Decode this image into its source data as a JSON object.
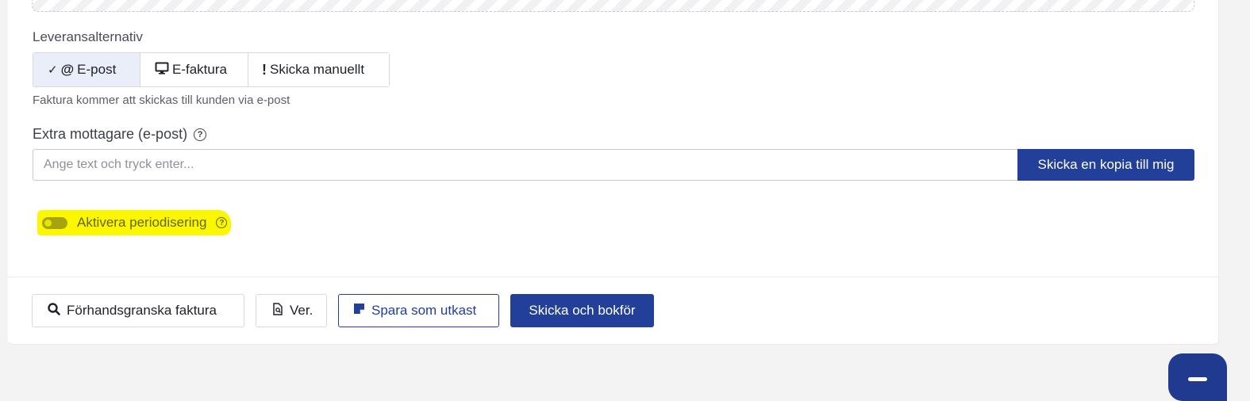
{
  "delivery": {
    "label": "Leveransalternativ",
    "options": [
      {
        "label": "E-post",
        "icon": "at-icon",
        "selected": true
      },
      {
        "label": "E-faktura",
        "icon": "monitor-icon",
        "selected": false
      },
      {
        "label": "Skicka manuellt",
        "icon": "exclamation-icon",
        "selected": false
      }
    ],
    "helper": "Faktura kommer att skickas till kunden via e-post"
  },
  "extra_recipients": {
    "label": "Extra mottagare (e-post)",
    "placeholder": "Ange text och tryck enter...",
    "value": "",
    "copy_button": "Skicka en kopia till mig"
  },
  "accrual": {
    "label": "Aktivera periodisering",
    "enabled": false
  },
  "footer": {
    "preview_button": "Förhandsgranska faktura",
    "version_button": "Ver.",
    "draft_button": "Spara som utkast",
    "submit_button": "Skicka och bokför"
  },
  "colors": {
    "primary": "#223f99",
    "highlight": "#fbf700"
  }
}
